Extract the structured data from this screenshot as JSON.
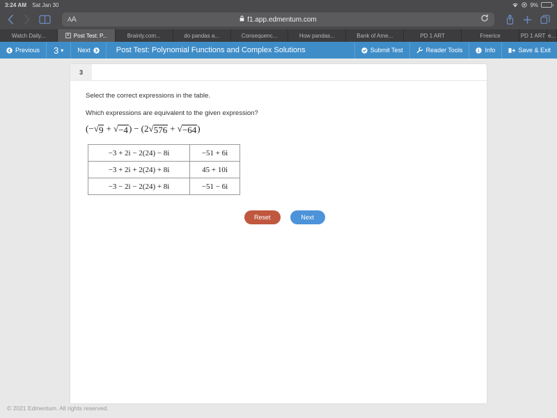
{
  "statusbar": {
    "time": "3:24 AM",
    "date": "Sat Jan 30",
    "battery_percent": "9%",
    "wifi_icon": "wifi-icon",
    "location_icon": "location-icon",
    "battery_icon": "battery-icon"
  },
  "browser": {
    "back_icon": "back-chevron-icon",
    "forward_icon": "forward-chevron-icon",
    "bookmarks_icon": "book-icon",
    "text_size_label": "AA",
    "lock_icon": "lock-icon",
    "url": "f1.app.edmentum.com",
    "reload_icon": "reload-icon",
    "share_icon": "share-icon",
    "newtab_icon": "plus-icon",
    "tabs_icon": "tabs-overview-icon",
    "tabs": [
      {
        "label": "Watch Daily...",
        "active": false,
        "closable": false
      },
      {
        "label": "Post Test: P...",
        "active": true,
        "closable": true
      },
      {
        "label": "Brainly.com...",
        "active": false,
        "closable": false
      },
      {
        "label": "do pandas a...",
        "active": false,
        "closable": false
      },
      {
        "label": "Consequenc...",
        "active": false,
        "closable": false
      },
      {
        "label": "How pandas...",
        "active": false,
        "closable": false
      },
      {
        "label": "Bank of Ame...",
        "active": false,
        "closable": false
      },
      {
        "label": "PD 1 ART",
        "active": false,
        "closable": false
      },
      {
        "label": "Freerice",
        "active": false,
        "closable": false
      },
      {
        "label": "PD 1 ART",
        "active": false,
        "closable": false
      },
      {
        "label": "e...",
        "active": false,
        "closable": false
      }
    ]
  },
  "navbar": {
    "previous_label": "Previous",
    "previous_icon": "circle-left-arrow-icon",
    "page_number": "3",
    "page_caret_icon": "chevron-down-icon",
    "next_label": "Next",
    "next_icon": "circle-right-arrow-icon",
    "title": "Post Test: Polynomial Functions and Complex Solutions",
    "submit_label": "Submit Test",
    "submit_icon": "check-circle-icon",
    "reader_tools_label": "Reader Tools",
    "reader_tools_icon": "wrench-icon",
    "info_label": "Info",
    "info_icon": "info-circle-icon",
    "save_exit_label": "Save & Exit",
    "save_exit_icon": "exit-arrow-icon"
  },
  "question": {
    "number": "3",
    "instruction": "Select the correct expressions in the table.",
    "prompt": "Which expressions are equivalent to the given expression?",
    "expression_text": "(−√9 + √−4) − (2√576 + √−64)",
    "expression_parts": {
      "open1": "(",
      "neg": "−",
      "rad1": "9",
      "plus1": "+",
      "rad2": "−4",
      "close1": ")",
      "minus": "−",
      "open2": "(",
      "coef": "2",
      "rad3": "576",
      "plus2": "+",
      "rad4": "−64",
      "close2": ")"
    },
    "table": {
      "rows": [
        {
          "left": "−3 + 2i − 2(24) − 8i",
          "right": "−51 + 6i"
        },
        {
          "left": "−3 + 2i + 2(24) + 8i",
          "right": "45 + 10i"
        },
        {
          "left": "−3 − 2i − 2(24) + 8i",
          "right": "−51 − 6i"
        }
      ]
    },
    "reset_label": "Reset",
    "next_label": "Next"
  },
  "footer": {
    "copyright": "© 2021 Edmentum. All rights reserved."
  },
  "colors": {
    "nav_blue": "#3f8dc8",
    "reset_red": "#c0573f",
    "next_blue": "#4d93d9",
    "chrome_gray": "#4a4a4c",
    "battery_red": "#e06a5c"
  }
}
